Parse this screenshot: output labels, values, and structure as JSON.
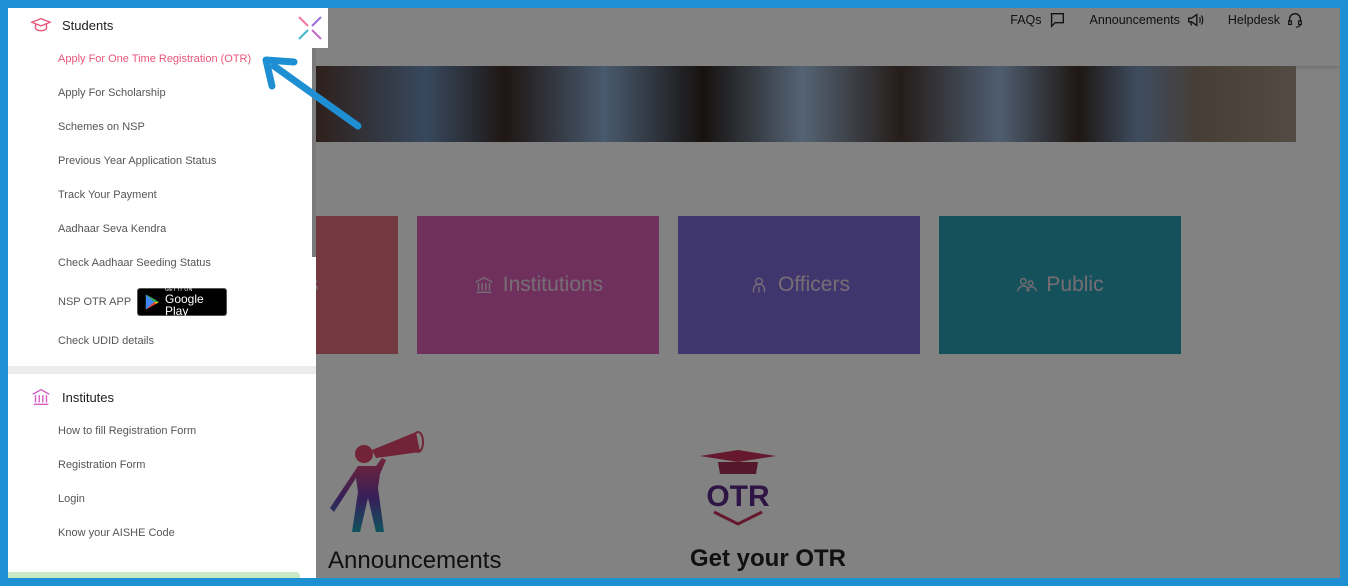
{
  "header": {
    "links": [
      {
        "label": "FAQs",
        "icon": "chat-bubble-icon"
      },
      {
        "label": "Announcements",
        "icon": "megaphone-icon"
      },
      {
        "label": "Helpdesk",
        "icon": "headset-icon"
      }
    ]
  },
  "tiles": [
    {
      "label": "Students",
      "visible_fragment": "ts",
      "icon": "graduation-cap-icon",
      "color": "#e3707e"
    },
    {
      "label": "Institutions",
      "icon": "bank-icon",
      "color": "#d95fb8"
    },
    {
      "label": "Officers",
      "icon": "person-icon",
      "color": "#7c6ad8"
    },
    {
      "label": "Public",
      "icon": "people-icon",
      "color": "#2aa0b2"
    }
  ],
  "features": {
    "announcements": {
      "title": "Announcements"
    },
    "otr": {
      "title": "Get your OTR",
      "logo_text": "OTR"
    }
  },
  "sidebar": {
    "students": {
      "title": "Students",
      "items": [
        {
          "label": "Apply For One Time Registration (OTR)",
          "active": true
        },
        {
          "label": "Apply For Scholarship"
        },
        {
          "label": "Schemes on NSP"
        },
        {
          "label": "Previous Year Application Status"
        },
        {
          "label": "Track Your Payment"
        },
        {
          "label": "Aadhaar Seva Kendra"
        },
        {
          "label": "Check Aadhaar Seeding Status"
        },
        {
          "label": "NSP OTR APP"
        },
        {
          "label": "Check UDID details"
        }
      ],
      "google_play": {
        "small": "GET IT ON",
        "big": "Google Play"
      }
    },
    "institutes": {
      "title": "Institutes",
      "items": [
        {
          "label": "How to fill Registration Form"
        },
        {
          "label": "Registration Form"
        },
        {
          "label": "Login"
        },
        {
          "label": "Know your AISHE Code"
        }
      ]
    }
  },
  "colors": {
    "accent_active": "#e8577a",
    "frame": "#1e8fd3",
    "annotation_arrow": "#1e8fd3"
  }
}
